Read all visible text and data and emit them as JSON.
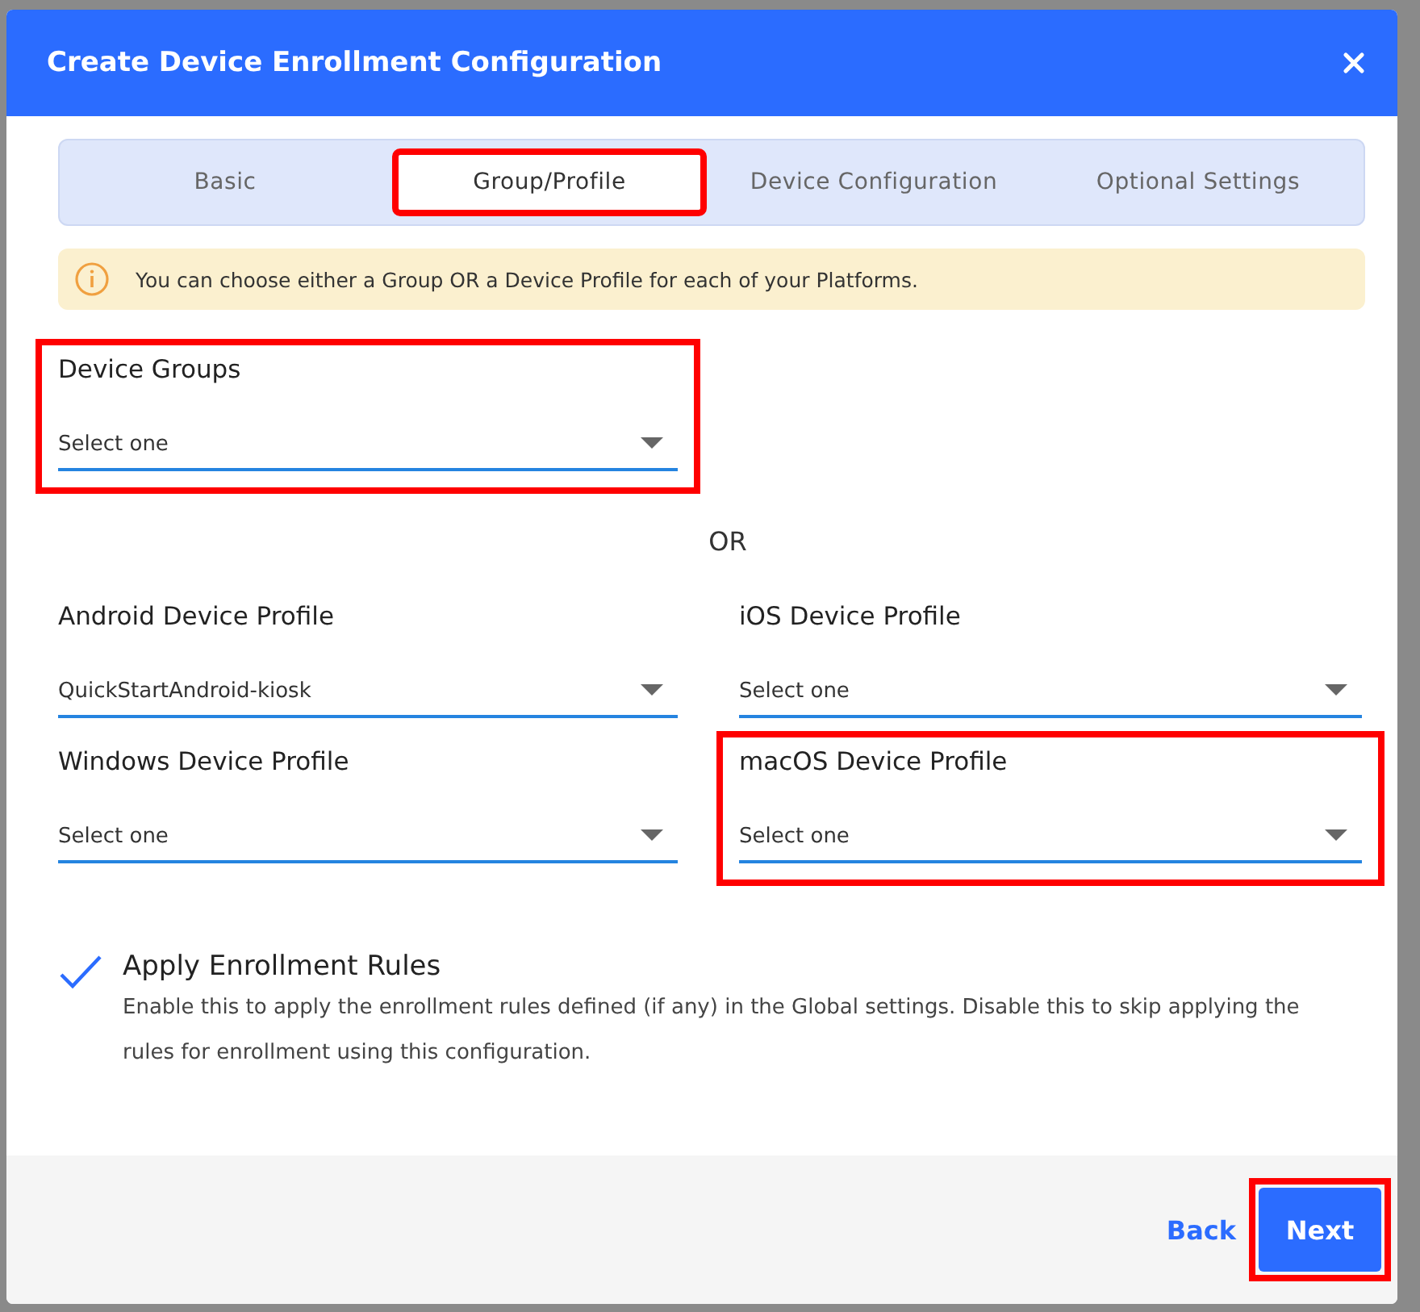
{
  "dialog": {
    "title": "Create Device Enrollment Configuration"
  },
  "tabs": [
    {
      "label": "Basic",
      "selected": false,
      "highlighted": false
    },
    {
      "label": "Group/Profile",
      "selected": true,
      "highlighted": true
    },
    {
      "label": "Device Configuration",
      "selected": false,
      "highlighted": false
    },
    {
      "label": "Optional Settings",
      "selected": false,
      "highlighted": false
    }
  ],
  "notice": {
    "text": "You can choose either a Group OR a Device Profile for each of your Platforms."
  },
  "device_groups": {
    "label": "Device Groups",
    "value": "Select one",
    "highlighted": true
  },
  "separator": "OR",
  "profiles": [
    {
      "label": "Android Device Profile",
      "value": "QuickStartAndroid-kiosk",
      "highlighted": false
    },
    {
      "label": "iOS Device Profile",
      "value": "Select one",
      "highlighted": false
    },
    {
      "label": "Windows Device Profile",
      "value": "Select one",
      "highlighted": false
    },
    {
      "label": "macOS Device Profile",
      "value": "Select one",
      "highlighted": true
    }
  ],
  "enrollment_rules": {
    "checked": true,
    "title": "Apply Enrollment Rules",
    "description": "Enable this to apply the enrollment rules defined (if any) in the Global settings. Disable this to skip applying the rules for enrollment using this configuration."
  },
  "footer": {
    "back": "Back",
    "next": {
      "label": "Next",
      "highlighted": true
    }
  }
}
